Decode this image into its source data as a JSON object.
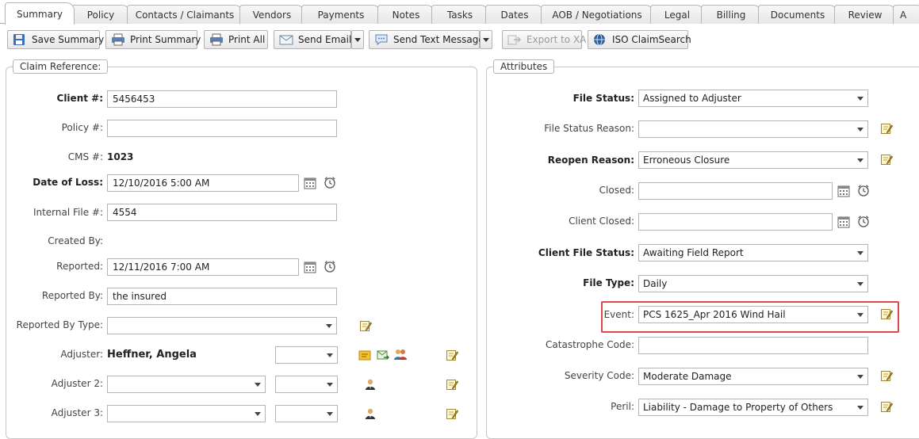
{
  "tabs": [
    {
      "label": "Summary",
      "active": true
    },
    {
      "label": "Policy"
    },
    {
      "label": "Contacts / Claimants"
    },
    {
      "label": "Vendors"
    },
    {
      "label": "Payments"
    },
    {
      "label": "Notes"
    },
    {
      "label": "Tasks"
    },
    {
      "label": "Dates"
    },
    {
      "label": "AOB / Negotiations"
    },
    {
      "label": "Legal"
    },
    {
      "label": "Billing"
    },
    {
      "label": "Documents"
    },
    {
      "label": "Review"
    },
    {
      "label": "A"
    }
  ],
  "toolbar": {
    "save_summary": "Save Summary",
    "print_summary": "Print Summary",
    "print_all": "Print All",
    "send_email": "Send Email",
    "send_text": "Send Text Message",
    "export_xa": "Export to XA",
    "iso_search": "ISO ClaimSearch"
  },
  "claim_reference": {
    "legend": "Claim Reference:",
    "client_label": "Client #:",
    "client_value": "5456453",
    "policy_label": "Policy #:",
    "policy_value": "",
    "cms_label": "CMS #:",
    "cms_value": "1023",
    "dol_label": "Date of Loss:",
    "dol_value": "12/10/2016 5:00 AM",
    "internal_label": "Internal File #:",
    "internal_value": "4554",
    "created_label": "Created By:",
    "reported_label": "Reported:",
    "reported_value": "12/11/2016 7:00 AM",
    "reported_by_label": "Reported By:",
    "reported_by_value": "the insured",
    "reported_type_label": "Reported By Type:",
    "reported_type_value": "",
    "adjuster_label": "Adjuster:",
    "adjuster_value": "Heffner, Angela",
    "adjuster2_label": "Adjuster 2:",
    "adjuster3_label": "Adjuster 3:"
  },
  "attributes": {
    "legend": "Attributes",
    "file_status_label": "File Status:",
    "file_status_value": "Assigned to Adjuster",
    "file_status_reason_label": "File Status Reason:",
    "file_status_reason_value": "",
    "reopen_label": "Reopen Reason:",
    "reopen_value": "Erroneous Closure",
    "closed_label": "Closed:",
    "closed_value": "",
    "client_closed_label": "Client Closed:",
    "client_closed_value": "",
    "client_file_status_label": "Client File Status:",
    "client_file_status_value": "Awaiting Field Report",
    "file_type_label": "File Type:",
    "file_type_value": "Daily",
    "event_label": "Event:",
    "event_value": "PCS 1625_Apr 2016 Wind Hail",
    "cat_code_label": "Catastrophe Code:",
    "cat_code_value": "",
    "severity_label": "Severity Code:",
    "severity_value": "Moderate Damage",
    "peril_label": "Peril:",
    "peril_value": "Liability - Damage to Property of Others"
  },
  "colors": {
    "highlight": "#e0474c",
    "border": "#b5b5b5"
  }
}
